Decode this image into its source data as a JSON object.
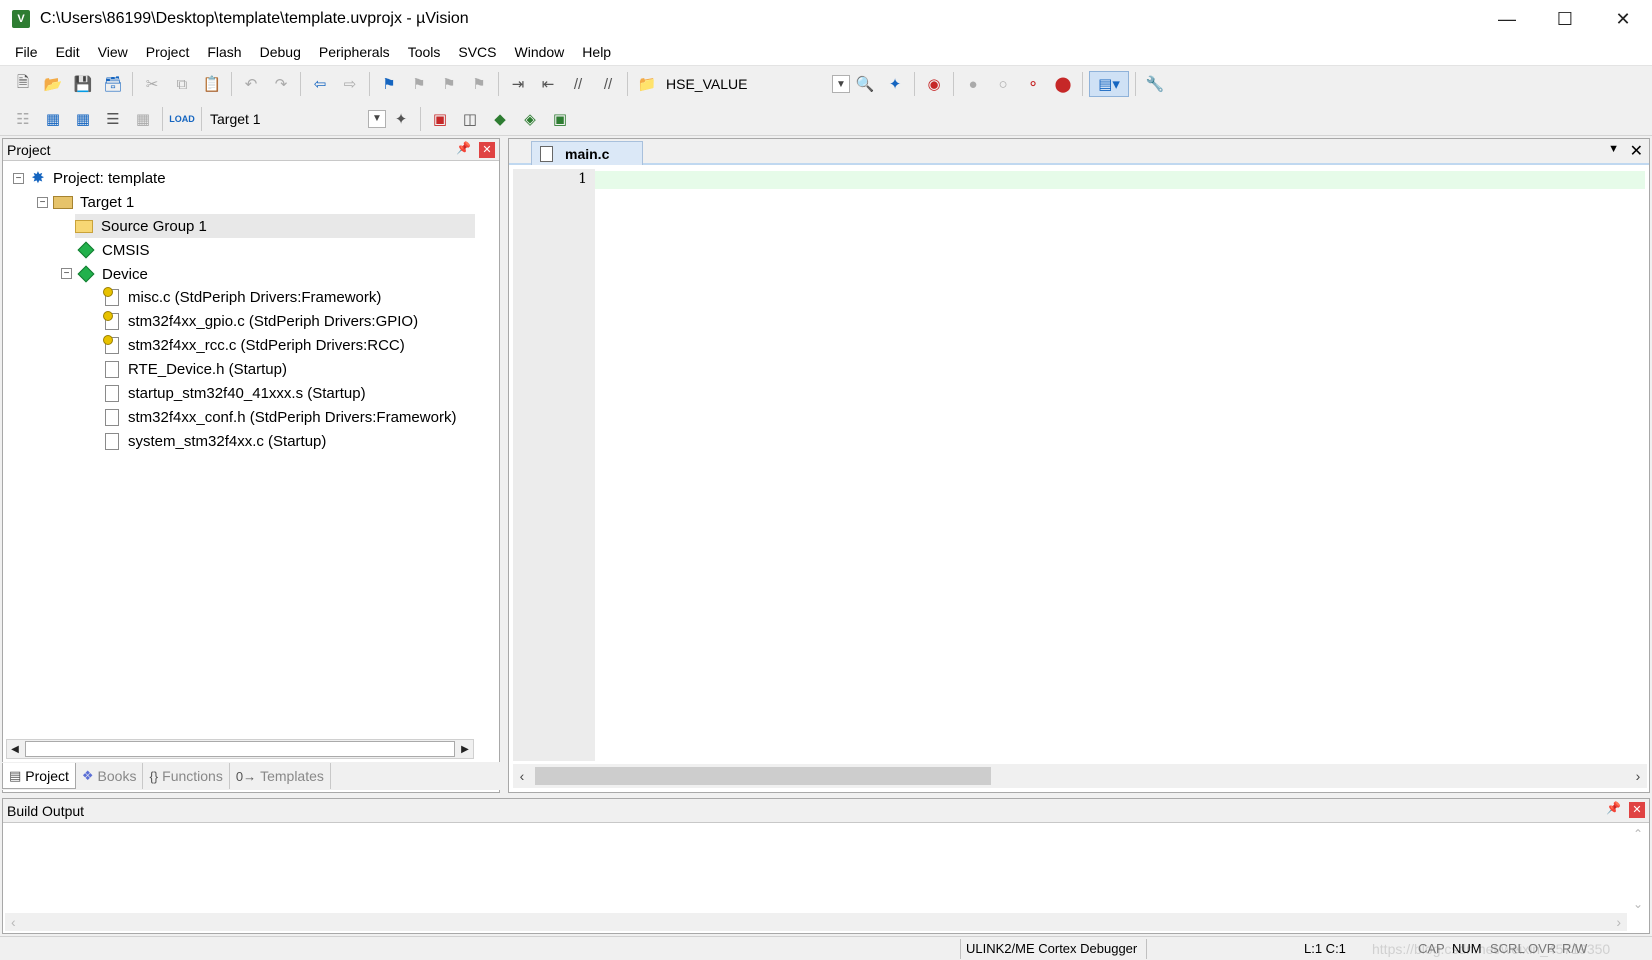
{
  "window": {
    "title": "C:\\Users\\86199\\Desktop\\template\\template.uvprojx - µVision",
    "icon_label": "V"
  },
  "menu": [
    "File",
    "Edit",
    "View",
    "Project",
    "Flash",
    "Debug",
    "Peripherals",
    "Tools",
    "SVCS",
    "Window",
    "Help"
  ],
  "toolbar1": {
    "find_combo_value": "HSE_VALUE"
  },
  "toolbar2": {
    "target_combo_value": "Target 1",
    "load_label": "LOAD"
  },
  "project_panel": {
    "title": "Project",
    "tree": [
      {
        "label": "Project: template"
      },
      {
        "label": "Target 1"
      },
      {
        "label": "Source Group 1"
      },
      {
        "label": "CMSIS"
      },
      {
        "label": "Device"
      },
      {
        "label": "misc.c (StdPeriph Drivers:Framework)"
      },
      {
        "label": "stm32f4xx_gpio.c (StdPeriph Drivers:GPIO)"
      },
      {
        "label": "stm32f4xx_rcc.c (StdPeriph Drivers:RCC)"
      },
      {
        "label": "RTE_Device.h (Startup)"
      },
      {
        "label": "startup_stm32f40_41xxx.s (Startup)"
      },
      {
        "label": "stm32f4xx_conf.h (StdPeriph Drivers:Framework)"
      },
      {
        "label": "system_stm32f4xx.c (Startup)"
      }
    ],
    "tabs": [
      "Project",
      "Books",
      "Functions",
      "Templates"
    ]
  },
  "editor": {
    "active_tab": "main.c",
    "line_number": "1"
  },
  "build_output": {
    "title": "Build Output"
  },
  "status": {
    "debugger": "ULINK2/ME Cortex Debugger",
    "position": "L:1 C:1",
    "cap": "CAP",
    "num": "NUM",
    "scrl": "SCRL",
    "ovr": "OVR",
    "rw": "R/W",
    "watermark": "https://blog.csdn.net/weixin_45719350"
  },
  "colors": {
    "current_line": "#e6fbe9",
    "close_button": "#e04343",
    "active_tab": "#dbe8f7"
  }
}
